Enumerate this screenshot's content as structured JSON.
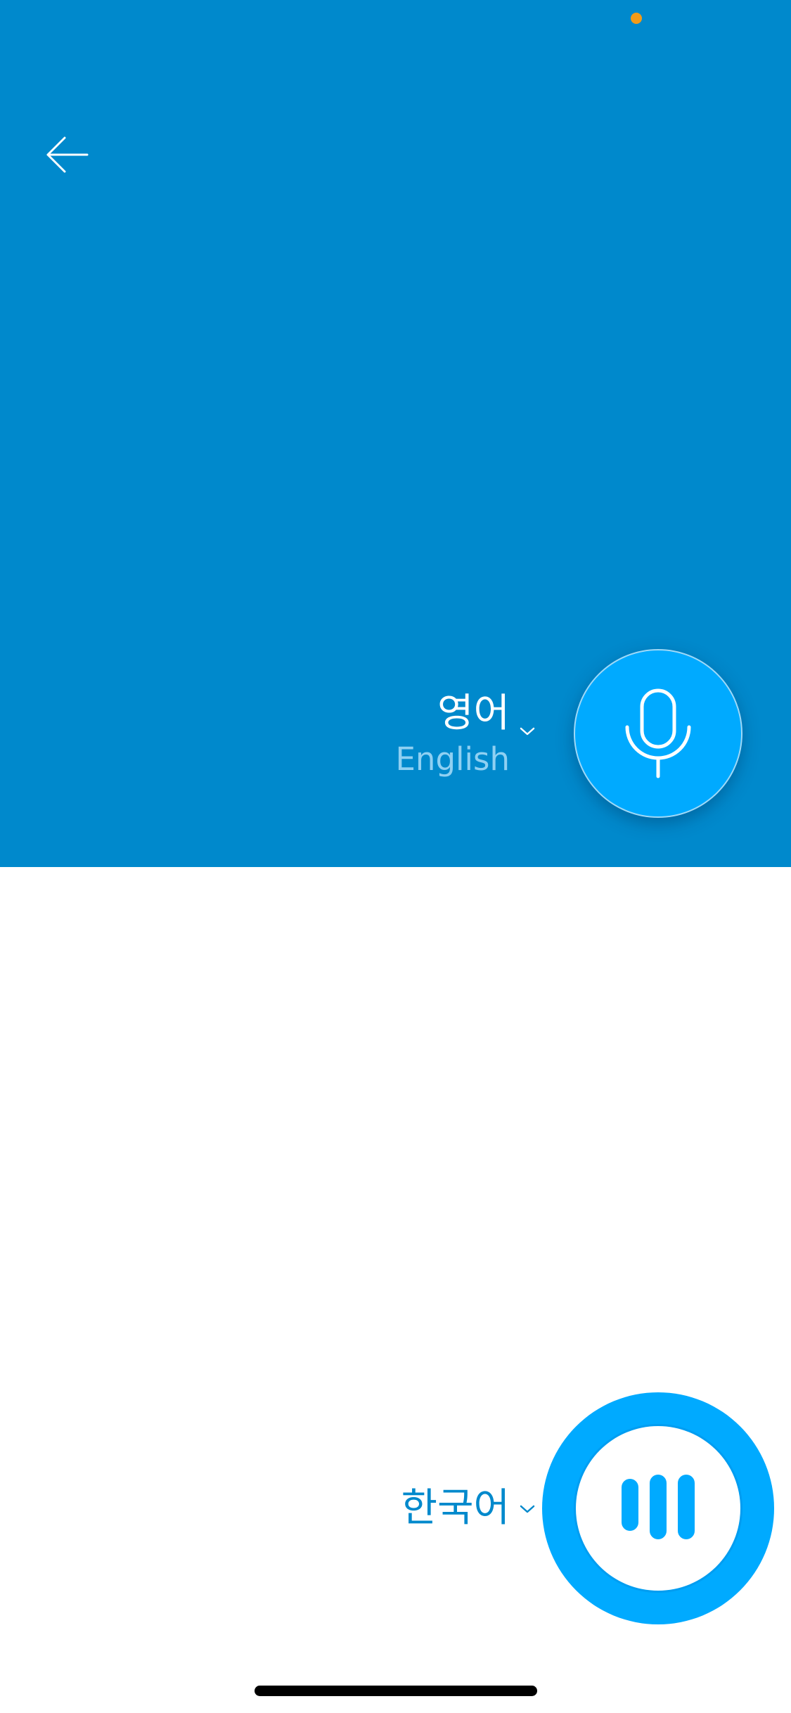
{
  "colors": {
    "top_background": "#0089CC",
    "bottom_background": "#FFFFFF",
    "accent": "#00AAFF",
    "source_english_text": "#8FD0F2",
    "target_text": "#0089CC",
    "status_dot": "#F29B18"
  },
  "icons": {
    "back": "arrow-left-icon",
    "source_dropdown": "chevron-down-icon",
    "mic": "microphone-icon",
    "target_dropdown": "chevron-down-icon",
    "listening": "audio-bars-icon"
  },
  "source_language": {
    "native_name": "영어",
    "english_name": "English"
  },
  "target_language": {
    "native_name": "한국어"
  }
}
